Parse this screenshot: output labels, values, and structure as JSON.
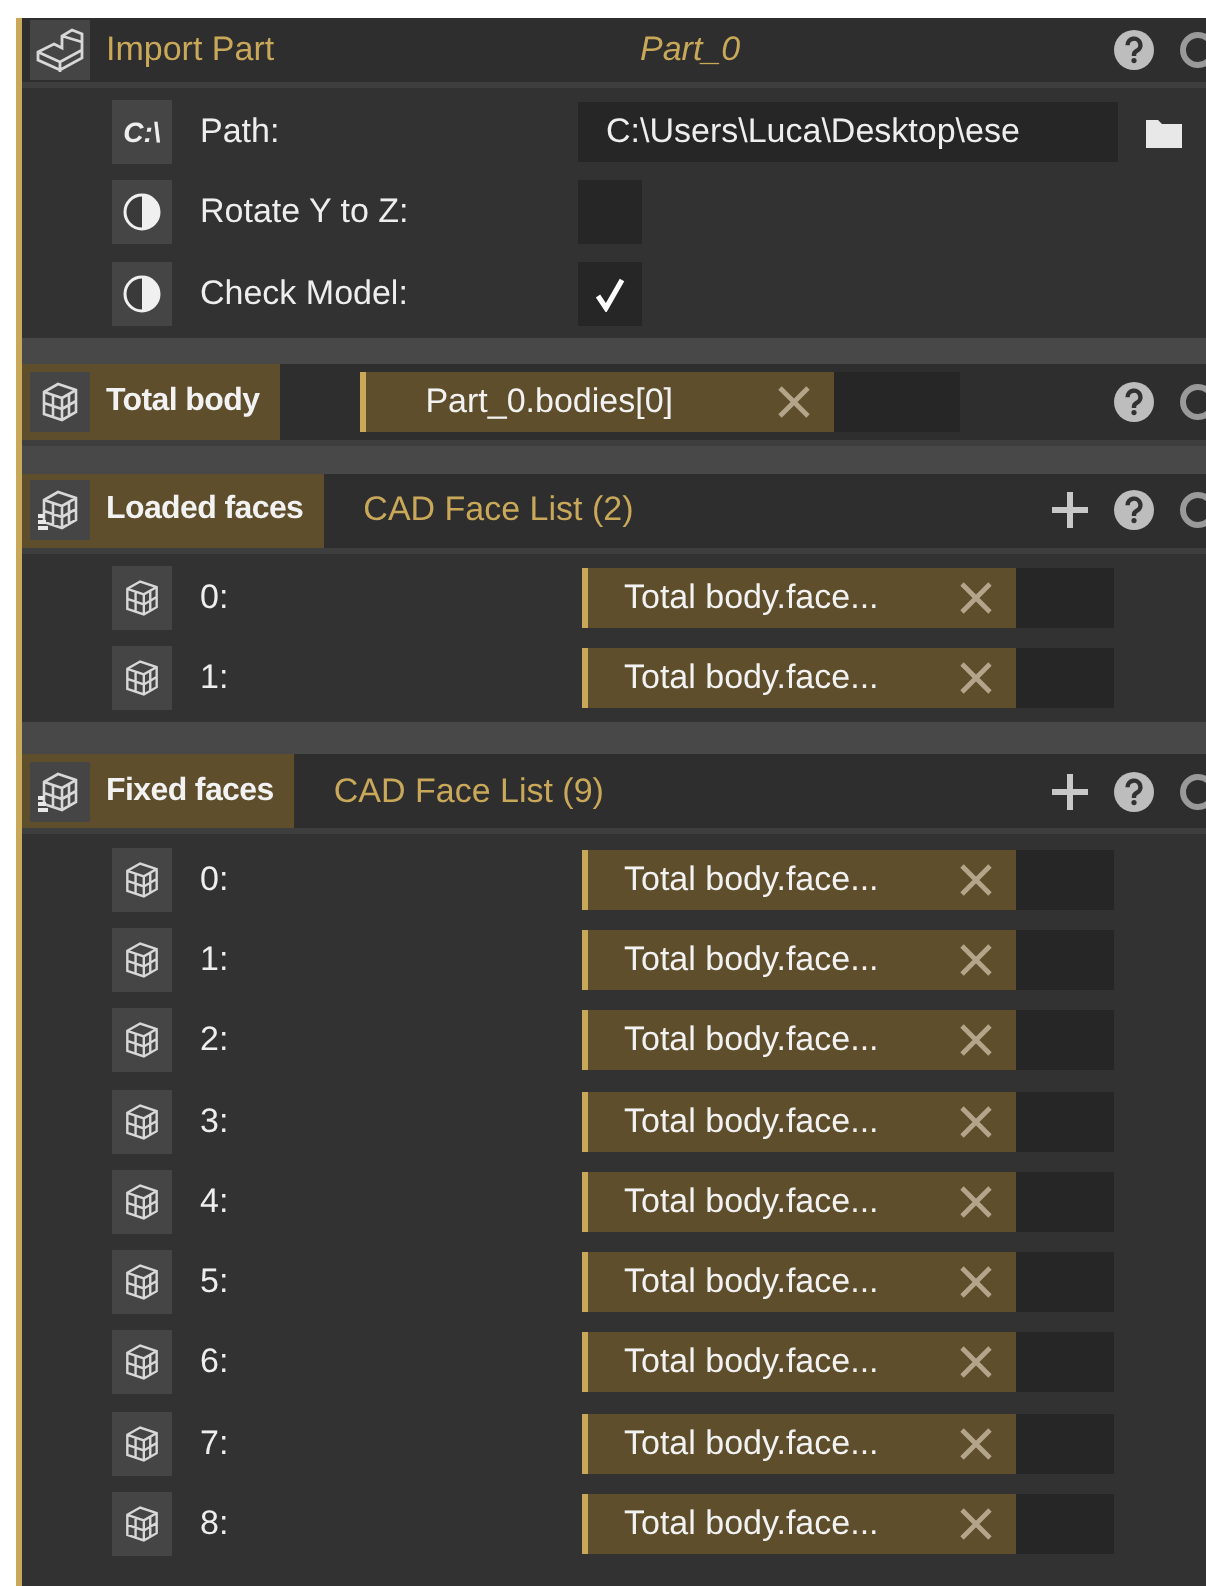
{
  "import_part": {
    "title": "Import Part",
    "instance": "Part_0",
    "params": [
      {
        "kind": "path",
        "icon_text": "C:\\",
        "label": "Path:",
        "value": "C:\\Users\\Luca\\Desktop\\ese"
      },
      {
        "kind": "checkbox",
        "label": "Rotate Y to Z:",
        "checked": false
      },
      {
        "kind": "checkbox",
        "label": "Check Model:",
        "checked": true
      }
    ]
  },
  "total_body": {
    "title": "Total body",
    "value": "Part_0.bodies[0]"
  },
  "face_lists": [
    {
      "title": "Loaded faces",
      "summary": "CAD Face List (2)",
      "items": [
        {
          "index": "0:",
          "value": "Total body.face..."
        },
        {
          "index": "1:",
          "value": "Total body.face..."
        }
      ]
    },
    {
      "title": "Fixed faces",
      "summary": "CAD Face List (9)",
      "items": [
        {
          "index": "0:",
          "value": "Total body.face..."
        },
        {
          "index": "1:",
          "value": "Total body.face..."
        },
        {
          "index": "2:",
          "value": "Total body.face..."
        },
        {
          "index": "3:",
          "value": "Total body.face..."
        },
        {
          "index": "4:",
          "value": "Total body.face..."
        },
        {
          "index": "5:",
          "value": "Total body.face..."
        },
        {
          "index": "6:",
          "value": "Total body.face..."
        },
        {
          "index": "7:",
          "value": "Total body.face..."
        },
        {
          "index": "8:",
          "value": "Total body.face..."
        }
      ]
    }
  ]
}
